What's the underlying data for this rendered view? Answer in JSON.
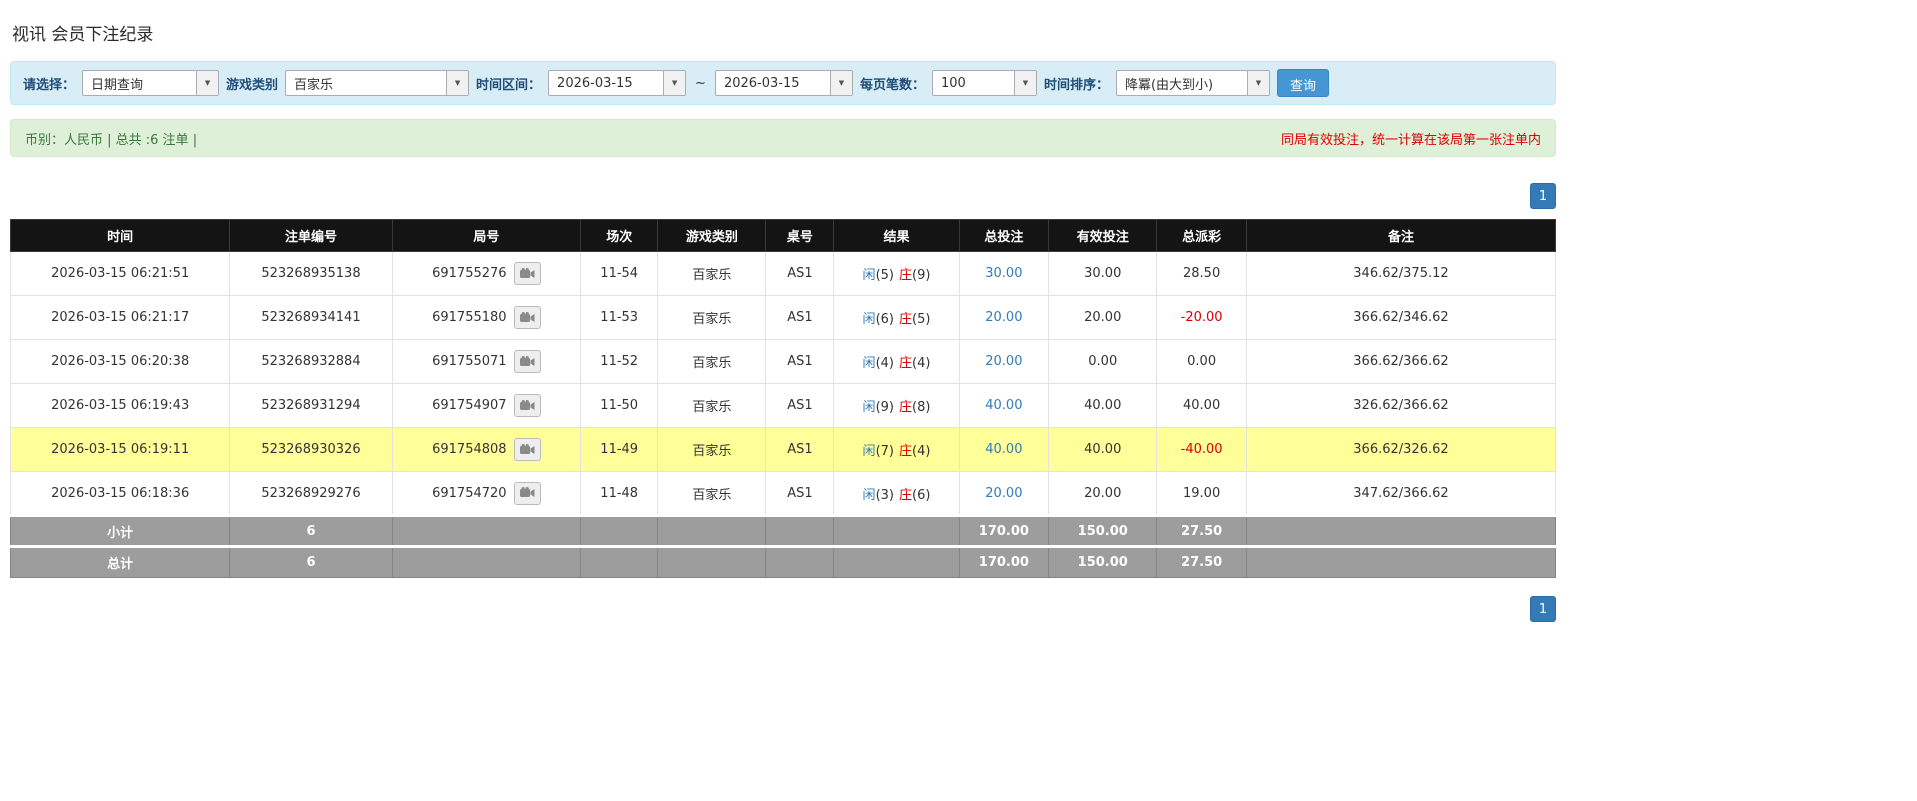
{
  "page": {
    "title": "视讯 会员下注纪录"
  },
  "filters": {
    "select_label": "请选择：",
    "select_value": "日期查询",
    "game_label": "游戏类别",
    "game_value": "百家乐",
    "range_label": "时间区间：",
    "date_from": "2026-03-15",
    "range_separator": "~",
    "date_to": "2026-03-15",
    "page_size_label": "每页笔数：",
    "page_size_value": "100",
    "sort_label": "时间排序：",
    "sort_value": "降冪(由大到小)",
    "search_button": "查询"
  },
  "summary": {
    "currency_info": "币别：人民币 | 总共 :6 注单 |",
    "note": "同局有效投注，统一计算在该局第一张注单内"
  },
  "pagination": {
    "page_1": "1"
  },
  "table": {
    "headers": [
      "时间",
      "注单编号",
      "局号",
      "场次",
      "游戏类别",
      "桌号",
      "结果",
      "总投注",
      "有效投注",
      "总派彩",
      "备注"
    ],
    "rows": [
      {
        "time": "2026-03-15 06:21:51",
        "bet_id": "523268935138",
        "round_id": "691755276",
        "session": "11-54",
        "game": "百家乐",
        "table_no": "AS1",
        "player": "闲",
        "player_score": "(5)",
        "banker": "庄",
        "banker_score": "(9)",
        "total_bet": "30.00",
        "valid_bet": "30.00",
        "payout": "28.50",
        "note": "346.62/375.12"
      },
      {
        "time": "2026-03-15 06:21:17",
        "bet_id": "523268934141",
        "round_id": "691755180",
        "session": "11-53",
        "game": "百家乐",
        "table_no": "AS1",
        "player": "闲",
        "player_score": "(6)",
        "banker": "庄",
        "banker_score": "(5)",
        "total_bet": "20.00",
        "valid_bet": "20.00",
        "payout": "-20.00",
        "note": "366.62/346.62"
      },
      {
        "time": "2026-03-15 06:20:38",
        "bet_id": "523268932884",
        "round_id": "691755071",
        "session": "11-52",
        "game": "百家乐",
        "table_no": "AS1",
        "player": "闲",
        "player_score": "(4)",
        "banker": "庄",
        "banker_score": "(4)",
        "total_bet": "20.00",
        "valid_bet": "0.00",
        "payout": "0.00",
        "note": "366.62/366.62"
      },
      {
        "time": "2026-03-15 06:19:43",
        "bet_id": "523268931294",
        "round_id": "691754907",
        "session": "11-50",
        "game": "百家乐",
        "table_no": "AS1",
        "player": "闲",
        "player_score": "(9)",
        "banker": "庄",
        "banker_score": "(8)",
        "total_bet": "40.00",
        "valid_bet": "40.00",
        "payout": "40.00",
        "note": "326.62/366.62"
      },
      {
        "time": "2026-03-15 06:19:11",
        "bet_id": "523268930326",
        "round_id": "691754808",
        "session": "11-49",
        "game": "百家乐",
        "table_no": "AS1",
        "player": "闲",
        "player_score": "(7)",
        "banker": "庄",
        "banker_score": "(4)",
        "total_bet": "40.00",
        "valid_bet": "40.00",
        "payout": "-40.00",
        "note": "366.62/326.62"
      },
      {
        "time": "2026-03-15 06:18:36",
        "bet_id": "523268929276",
        "round_id": "691754720",
        "session": "11-48",
        "game": "百家乐",
        "table_no": "AS1",
        "player": "闲",
        "player_score": "(3)",
        "banker": "庄",
        "banker_score": "(6)",
        "total_bet": "20.00",
        "valid_bet": "20.00",
        "payout": "19.00",
        "note": "347.62/366.62"
      }
    ],
    "subtotal": {
      "label": "小计",
      "count": "6",
      "total_bet": "170.00",
      "valid_bet": "150.00",
      "payout": "27.50"
    },
    "grand_total": {
      "label": "总计",
      "count": "6",
      "total_bet": "170.00",
      "valid_bet": "150.00",
      "payout": "27.50"
    }
  },
  "colors": {
    "accent_blue": "#337ab7",
    "player_blue": "#337ab7",
    "banker_red": "#dd0000",
    "negative_red": "#dd0000",
    "highlight_yellow": "#ffff99",
    "table_header_black": "#141414",
    "summary_row_gray": "#9d9d9d",
    "filter_bar_bg": "#d9edf7",
    "info_bar_bg": "#dff0d8",
    "search_button_blue": "#4596d3"
  }
}
